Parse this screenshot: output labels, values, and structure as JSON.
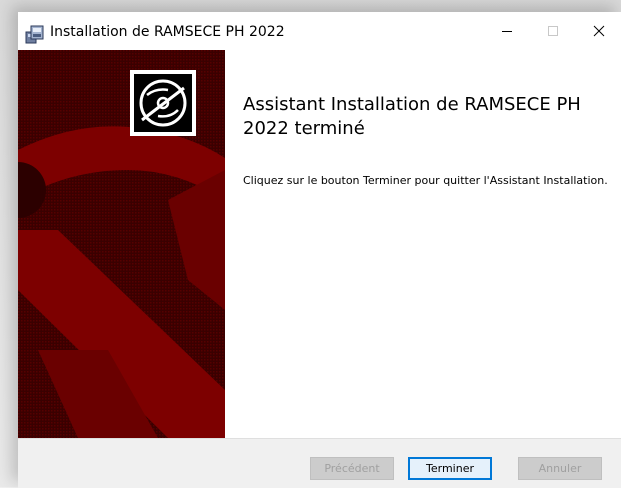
{
  "window": {
    "title": "Installation de RAMSECE PH 2022",
    "controls": {
      "minimize_icon": "minimize-icon",
      "maximize_icon": "maximize-icon",
      "close_icon": "close-icon"
    }
  },
  "banner": {
    "icon": "disc-icon",
    "colors": {
      "background": "#7a0000",
      "dark": "#2a0000",
      "pattern": "#8b0000"
    }
  },
  "content": {
    "heading": "Assistant Installation de RAMSECE PH 2022 terminé",
    "body": "Cliquez sur le bouton Terminer pour quitter l'Assistant Installation."
  },
  "footer": {
    "back_label": "Précédent",
    "finish_label": "Terminer",
    "cancel_label": "Annuler"
  },
  "colors": {
    "accent": "#0078d7"
  }
}
